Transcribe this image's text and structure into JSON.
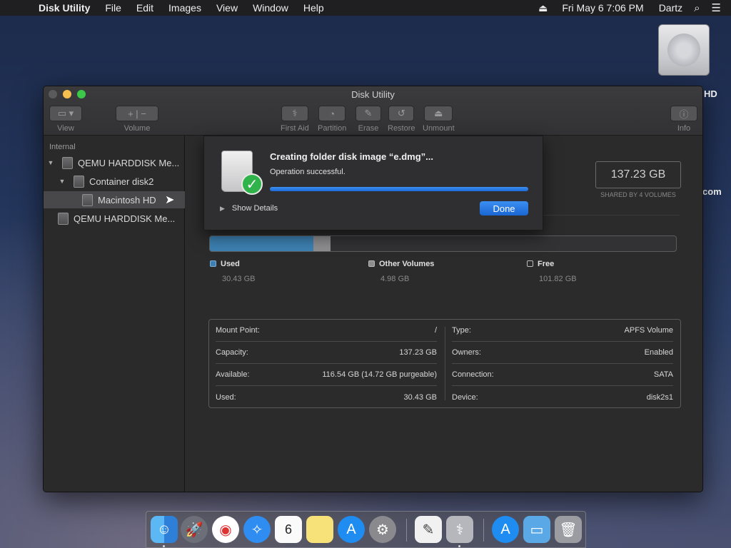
{
  "menubar": {
    "app_name": "Disk Utility",
    "menus": [
      "File",
      "Edit",
      "Images",
      "View",
      "Window",
      "Help"
    ],
    "clock": "Fri May 6  7:06 PM",
    "user": "Dartz"
  },
  "desktop": {
    "label_1": "HD",
    "label_2": "com"
  },
  "window": {
    "title": "Disk Utility",
    "toolbar": {
      "view": "View",
      "volume": "Volume",
      "first_aid": "First Aid",
      "partition": "Partition",
      "erase": "Erase",
      "restore": "Restore",
      "unmount": "Unmount",
      "info": "Info"
    }
  },
  "sidebar": {
    "heading": "Internal",
    "items": [
      {
        "label": "QEMU HARDDISK Me...",
        "level": 0
      },
      {
        "label": "Container disk2",
        "level": 1
      },
      {
        "label": "Macintosh HD",
        "level": 2
      },
      {
        "label": "QEMU HARDDISK Me...",
        "level": 0
      }
    ]
  },
  "main": {
    "capacity": "137.23 GB",
    "capacity_sub": "SHARED BY 4 VOLUMES",
    "usage": {
      "used_fraction": 0.2218,
      "other_fraction": 0.0363
    },
    "legend": {
      "used_label": "Used",
      "used_value": "30.43 GB",
      "other_label": "Other Volumes",
      "other_value": "4.98 GB",
      "free_label": "Free",
      "free_value": "101.82 GB"
    },
    "info": {
      "left": [
        {
          "k": "Mount Point:",
          "v": "/"
        },
        {
          "k": "Capacity:",
          "v": "137.23 GB"
        },
        {
          "k": "Available:",
          "v": "116.54 GB (14.72 GB purgeable)"
        },
        {
          "k": "Used:",
          "v": "30.43 GB"
        }
      ],
      "right": [
        {
          "k": "Type:",
          "v": "APFS Volume"
        },
        {
          "k": "Owners:",
          "v": "Enabled"
        },
        {
          "k": "Connection:",
          "v": "SATA"
        },
        {
          "k": "Device:",
          "v": "disk2s1"
        }
      ]
    }
  },
  "sheet": {
    "title": "Creating folder disk image “e.dmg”...",
    "status": "Operation successful.",
    "progress": 1.0,
    "show_details": "Show Details",
    "done": "Done"
  },
  "colors": {
    "used": "#3c7fb0",
    "other": "#8d8d8f",
    "accent": "#1a66d2"
  }
}
